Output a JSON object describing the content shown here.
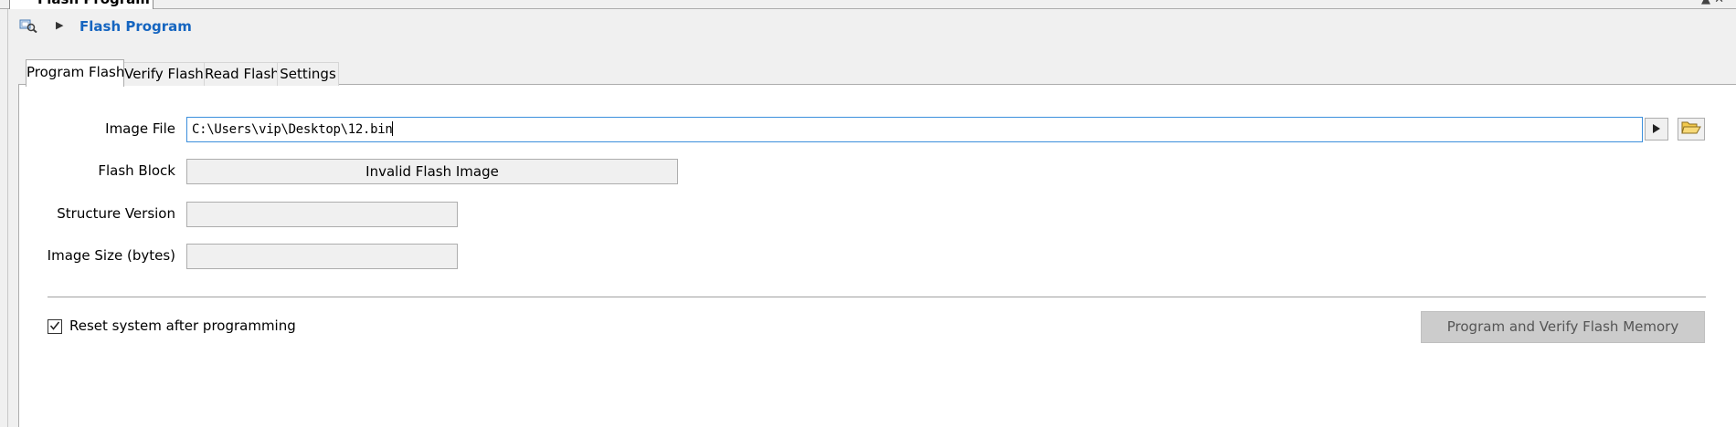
{
  "window": {
    "tab_title": "Flash Program",
    "controls": "▲ ✕"
  },
  "header": {
    "title": "Flash Program"
  },
  "tabs": [
    {
      "label": "Program Flash",
      "active": true
    },
    {
      "label": "Verify Flash",
      "active": false
    },
    {
      "label": "Read Flash",
      "active": false
    },
    {
      "label": "Settings",
      "active": false
    }
  ],
  "form": {
    "image_file": {
      "label": "Image File",
      "value": "C:\\Users\\vip\\Desktop\\12.bin"
    },
    "flash_block": {
      "label": "Flash Block",
      "value": "Invalid Flash Image"
    },
    "structure_version": {
      "label": "Structure Version",
      "value": ""
    },
    "image_size": {
      "label": "Image Size (bytes)",
      "value": ""
    }
  },
  "options": {
    "reset_label": "Reset system after programming",
    "reset_checked": true
  },
  "actions": {
    "program_verify_label": "Program and Verify Flash Memory"
  },
  "colors": {
    "accent": "#1565c0",
    "input_focus": "#3c8fdc",
    "disabled_button": "#cccccc"
  }
}
